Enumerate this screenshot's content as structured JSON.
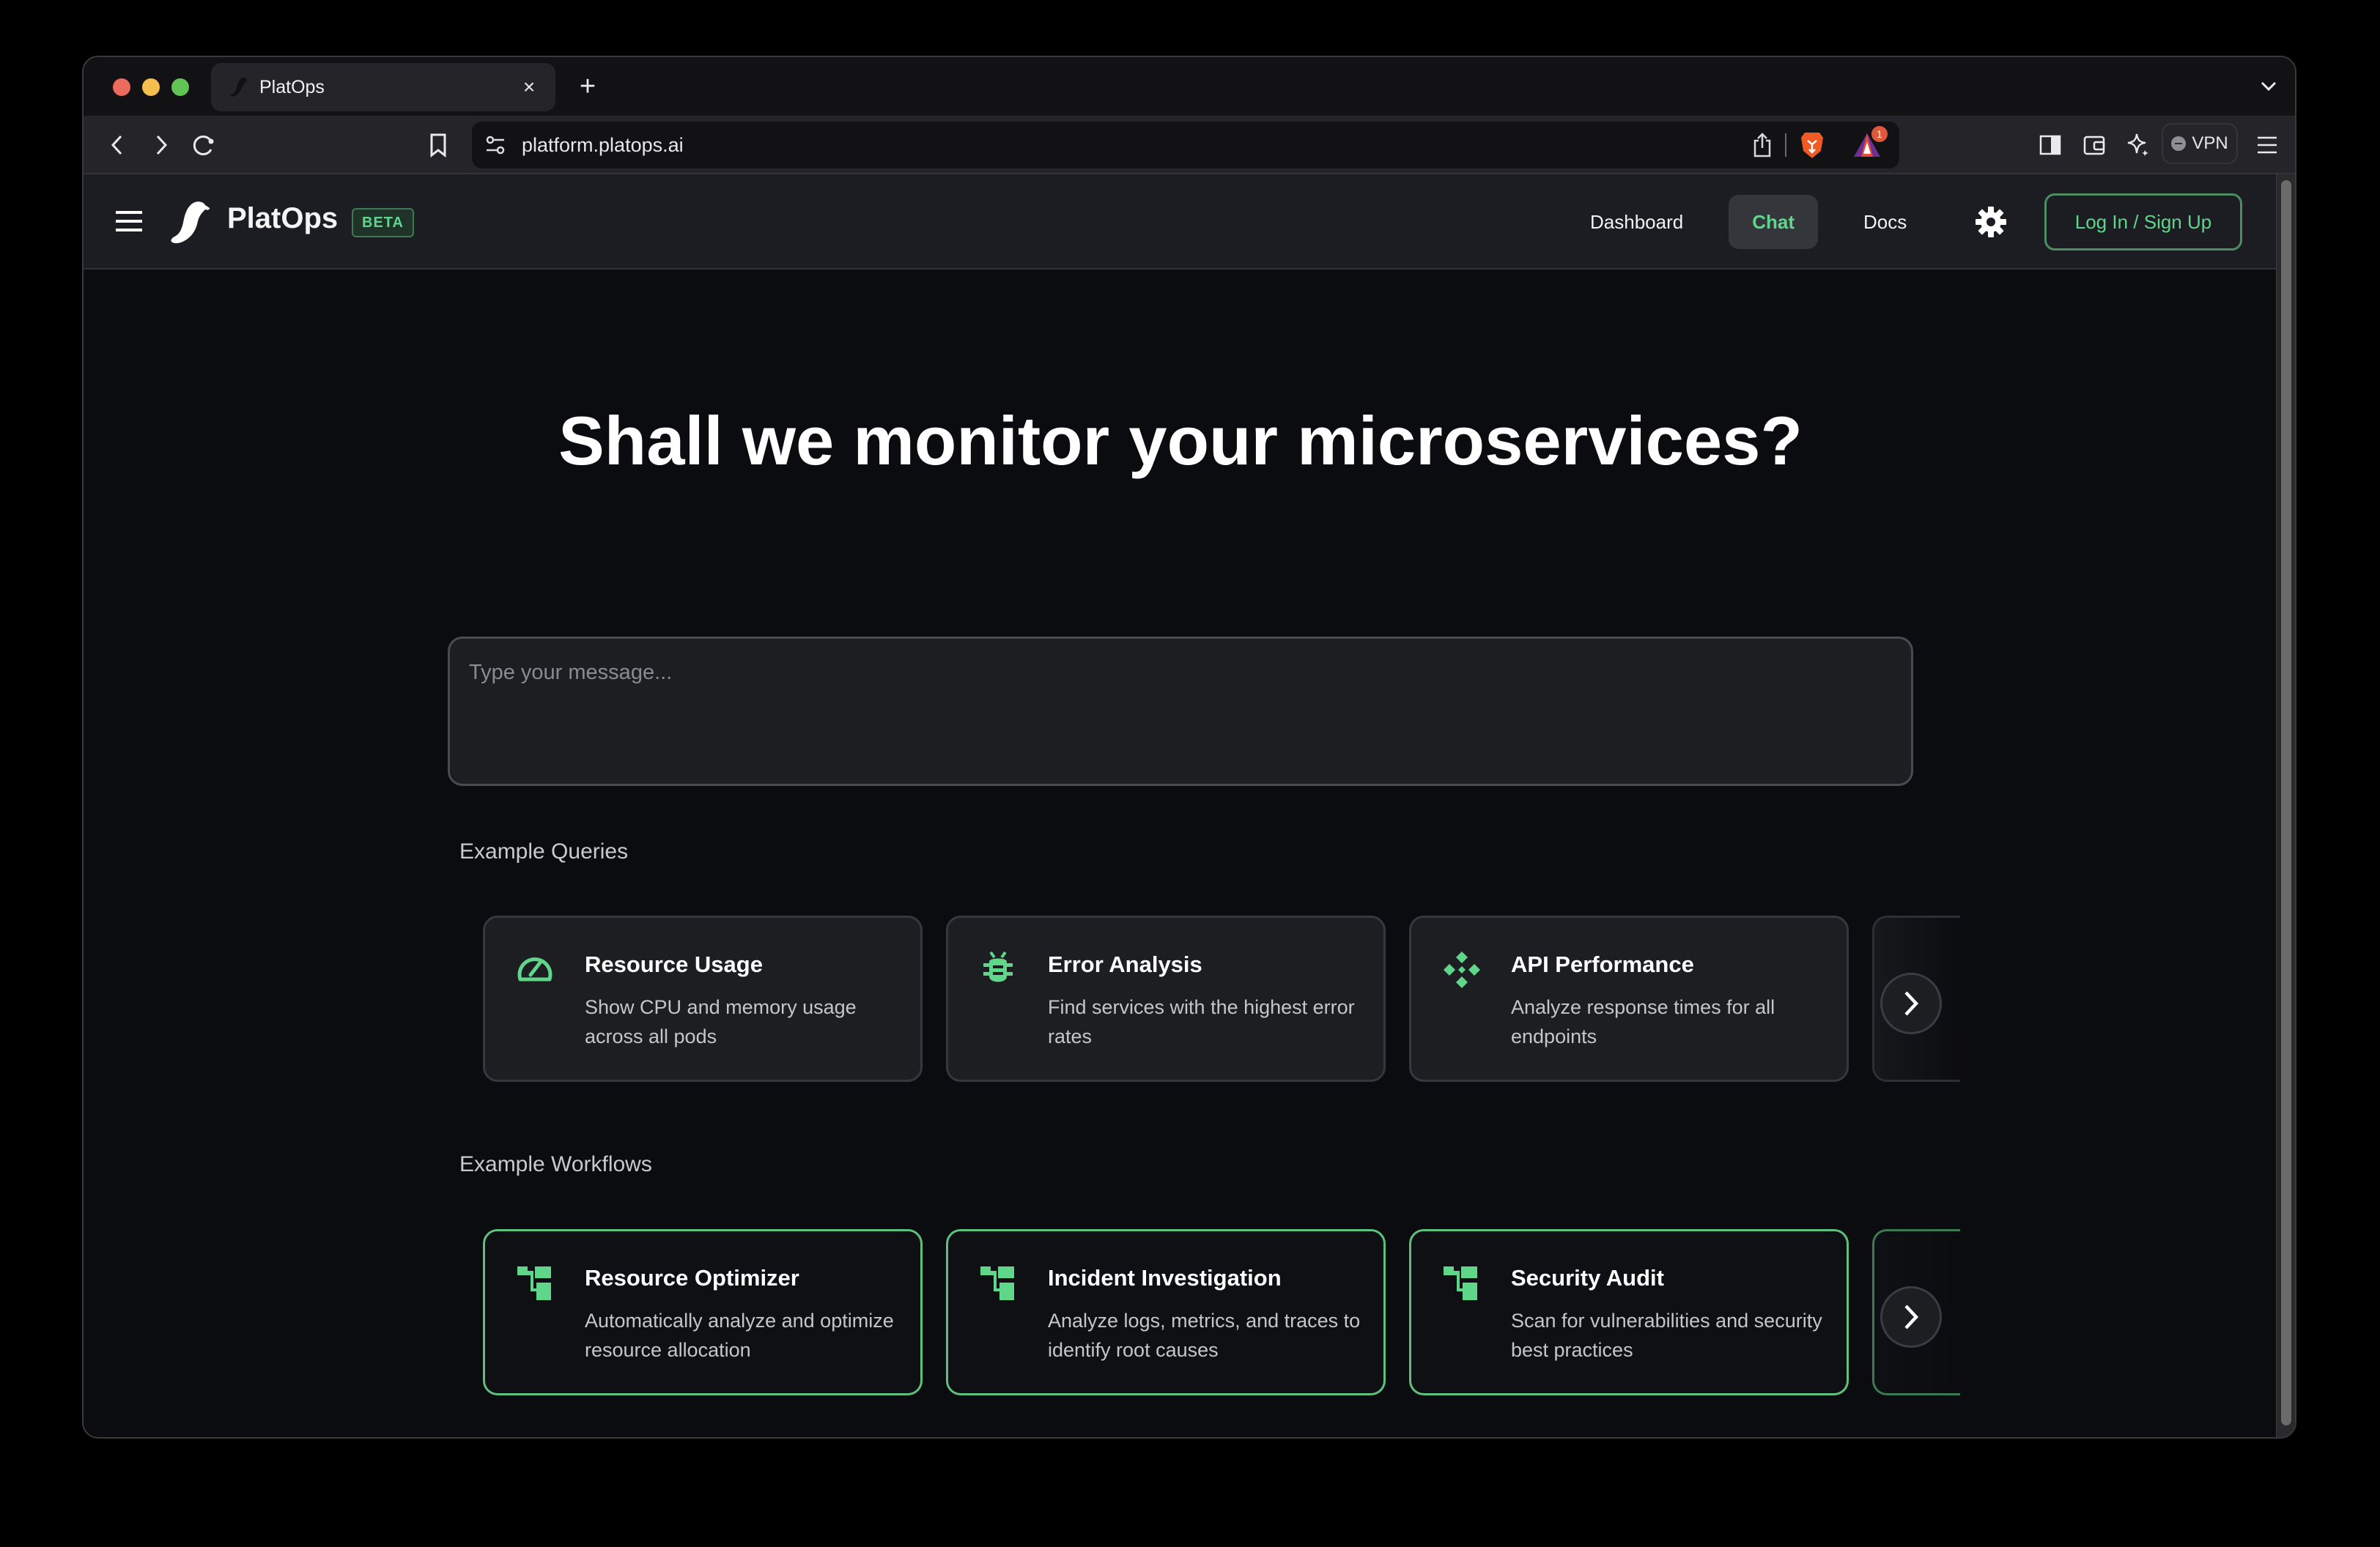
{
  "browser": {
    "tab_title": "PlatOps",
    "url": "platform.platops.ai",
    "vpn_label": "VPN",
    "notification_count": "1"
  },
  "app": {
    "brand": "PlatOps",
    "badge": "BETA",
    "nav": [
      {
        "label": "Dashboard",
        "active": false
      },
      {
        "label": "Chat",
        "active": true
      },
      {
        "label": "Docs",
        "active": false
      }
    ],
    "login_label": "Log In / Sign Up",
    "accent_color": "#5fd68a"
  },
  "main": {
    "headline": "Shall we monitor your microservices?",
    "input_placeholder": "Type your message...",
    "queries_label": "Example Queries",
    "workflows_label": "Example Workflows",
    "queries": [
      {
        "icon": "speedometer-icon",
        "title": "Resource Usage",
        "description": "Show CPU and memory usage across all pods"
      },
      {
        "icon": "bug-icon",
        "title": "Error Analysis",
        "description": "Find services with the highest error rates"
      },
      {
        "icon": "api-diamond-icon",
        "title": "API Performance",
        "description": "Analyze response times for all endpoints"
      }
    ],
    "workflows": [
      {
        "icon": "workflow-icon",
        "title": "Resource Optimizer",
        "description": "Automatically analyze and optimize resource allocation"
      },
      {
        "icon": "workflow-icon",
        "title": "Incident Investigation",
        "description": "Analyze logs, metrics, and traces to identify root causes"
      },
      {
        "icon": "workflow-icon",
        "title": "Security Audit",
        "description": "Scan for vulnerabilities and security best practices"
      }
    ]
  }
}
